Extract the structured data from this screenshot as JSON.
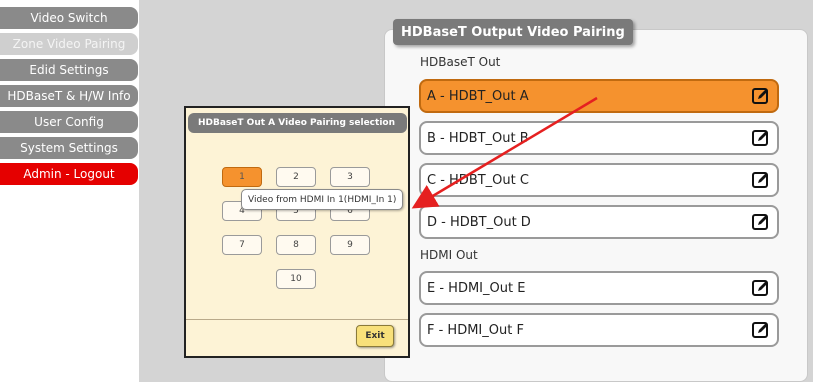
{
  "sidebar": {
    "items": [
      {
        "label": "Video Switch",
        "state": "normal"
      },
      {
        "label": "Zone Video Pairing",
        "state": "active"
      },
      {
        "label": "Edid Settings",
        "state": "normal"
      },
      {
        "label": "HDBaseT & H/W Info",
        "state": "normal"
      },
      {
        "label": "User Config",
        "state": "normal"
      },
      {
        "label": "System Settings",
        "state": "normal"
      },
      {
        "label": "Admin - Logout",
        "state": "logout"
      }
    ]
  },
  "panel": {
    "title": "HDBaseT Output Video Pairing",
    "hdbaset_label": "HDBaseT Out",
    "hdmi_label": "HDMI Out",
    "outputs": [
      {
        "label": "A - HDBT_Out A",
        "selected": true
      },
      {
        "label": "B - HDBT_Out B",
        "selected": false
      },
      {
        "label": "C - HDBT_Out C",
        "selected": false
      },
      {
        "label": "D - HDBT_Out D",
        "selected": false
      },
      {
        "label": "E - HDMI_Out E",
        "selected": false
      },
      {
        "label": "F - HDMI_Out F",
        "selected": false
      }
    ],
    "edit_icon": "edit-icon"
  },
  "popup": {
    "title": "HDBaseT Out A Video Pairing selection",
    "buttons": [
      "1",
      "2",
      "3",
      "4",
      "5",
      "6",
      "7",
      "8",
      "9",
      "10"
    ],
    "selected": "1",
    "tooltip": "Video from HDMI In 1(HDMI_In 1)",
    "exit_label": "Exit"
  },
  "colors": {
    "accent": "#f5922e",
    "logout": "#e50000",
    "arrow": "#e52020"
  }
}
